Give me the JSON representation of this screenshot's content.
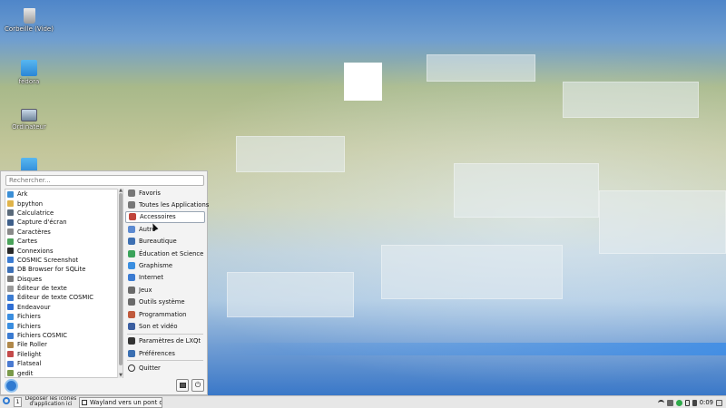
{
  "desktop": {
    "icons": [
      {
        "label": "Corbeille (Vide)",
        "icon": "trash-icon"
      },
      {
        "label": "fedora",
        "icon": "folder-home-icon"
      },
      {
        "label": "Ordinateur",
        "icon": "computer-icon"
      },
      {
        "label": "",
        "icon": "folder-icon"
      }
    ]
  },
  "menu": {
    "search_placeholder": "Rechercher...",
    "apps": [
      {
        "label": "Ark",
        "color": "#3b8fd6"
      },
      {
        "label": "bpython",
        "color": "#e0b44a"
      },
      {
        "label": "Calculatrice",
        "color": "#5a6a7a"
      },
      {
        "label": "Capture d'écran",
        "color": "#3e5f8a"
      },
      {
        "label": "Caractères",
        "color": "#8a8a8a"
      },
      {
        "label": "Cartes",
        "color": "#4aa35a"
      },
      {
        "label": "Connexions",
        "color": "#2a2a2a"
      },
      {
        "label": "COSMIC Screenshot",
        "color": "#3b7bd1"
      },
      {
        "label": "DB Browser for SQLite",
        "color": "#3c6fb5"
      },
      {
        "label": "Disques",
        "color": "#7a7a7a"
      },
      {
        "label": "Éditeur de texte",
        "color": "#9a9a9a"
      },
      {
        "label": "Éditeur de texte COSMIC",
        "color": "#3b7bd1"
      },
      {
        "label": "Endeavour",
        "color": "#2f6ed3"
      },
      {
        "label": "Fichiers",
        "color": "#3a8ee0"
      },
      {
        "label": "Fichiers",
        "color": "#3a8ee0"
      },
      {
        "label": "Fichiers COSMIC",
        "color": "#3b7bd1"
      },
      {
        "label": "File Roller",
        "color": "#b0884a"
      },
      {
        "label": "Filelight",
        "color": "#c44a4a"
      },
      {
        "label": "Flatseal",
        "color": "#4a7ad1"
      },
      {
        "label": "gedit",
        "color": "#7a9a4a"
      }
    ],
    "categories": [
      {
        "label": "Favoris",
        "icon": "bookmark-icon",
        "color": "#777777"
      },
      {
        "label": "Toutes les Applications",
        "icon": "grid-icon",
        "color": "#777777"
      },
      {
        "label": "Accessoires",
        "icon": "toolbox-icon",
        "color": "#c0453c",
        "selected": true
      },
      {
        "label": "Autre",
        "icon": "cube-icon",
        "color": "#5c8ad1"
      },
      {
        "label": "Bureautique",
        "icon": "office-icon",
        "color": "#3d6fb2"
      },
      {
        "label": "Éducation et Science",
        "icon": "flask-icon",
        "color": "#3aa35a"
      },
      {
        "label": "Graphisme",
        "icon": "palette-icon",
        "color": "#3a8ee0"
      },
      {
        "label": "Internet",
        "icon": "globe-icon",
        "color": "#3b7bd1"
      },
      {
        "label": "Jeux",
        "icon": "gamepad-icon",
        "color": "#6a6a6a"
      },
      {
        "label": "Outils système",
        "icon": "gear-icon",
        "color": "#6a6a6a"
      },
      {
        "label": "Programmation",
        "icon": "wrench-icon",
        "color": "#c05a3c"
      },
      {
        "label": "Son et vidéo",
        "icon": "media-icon",
        "color": "#3a5ea0"
      }
    ],
    "bottom_categories": [
      {
        "label": "Paramètres de LXQt",
        "icon": "settings-icon",
        "color": "#333333"
      },
      {
        "label": "Préférences",
        "icon": "preferences-icon",
        "color": "#3a6fb2"
      }
    ],
    "quit_label": "Quitter",
    "power_glyph": "⏻"
  },
  "taskbar": {
    "desktop_number": "1",
    "quicklaunch_text": "Déposer les icônes d'application ici",
    "window_title": "Wayland vers un pont d'...",
    "clock": "0:09"
  }
}
